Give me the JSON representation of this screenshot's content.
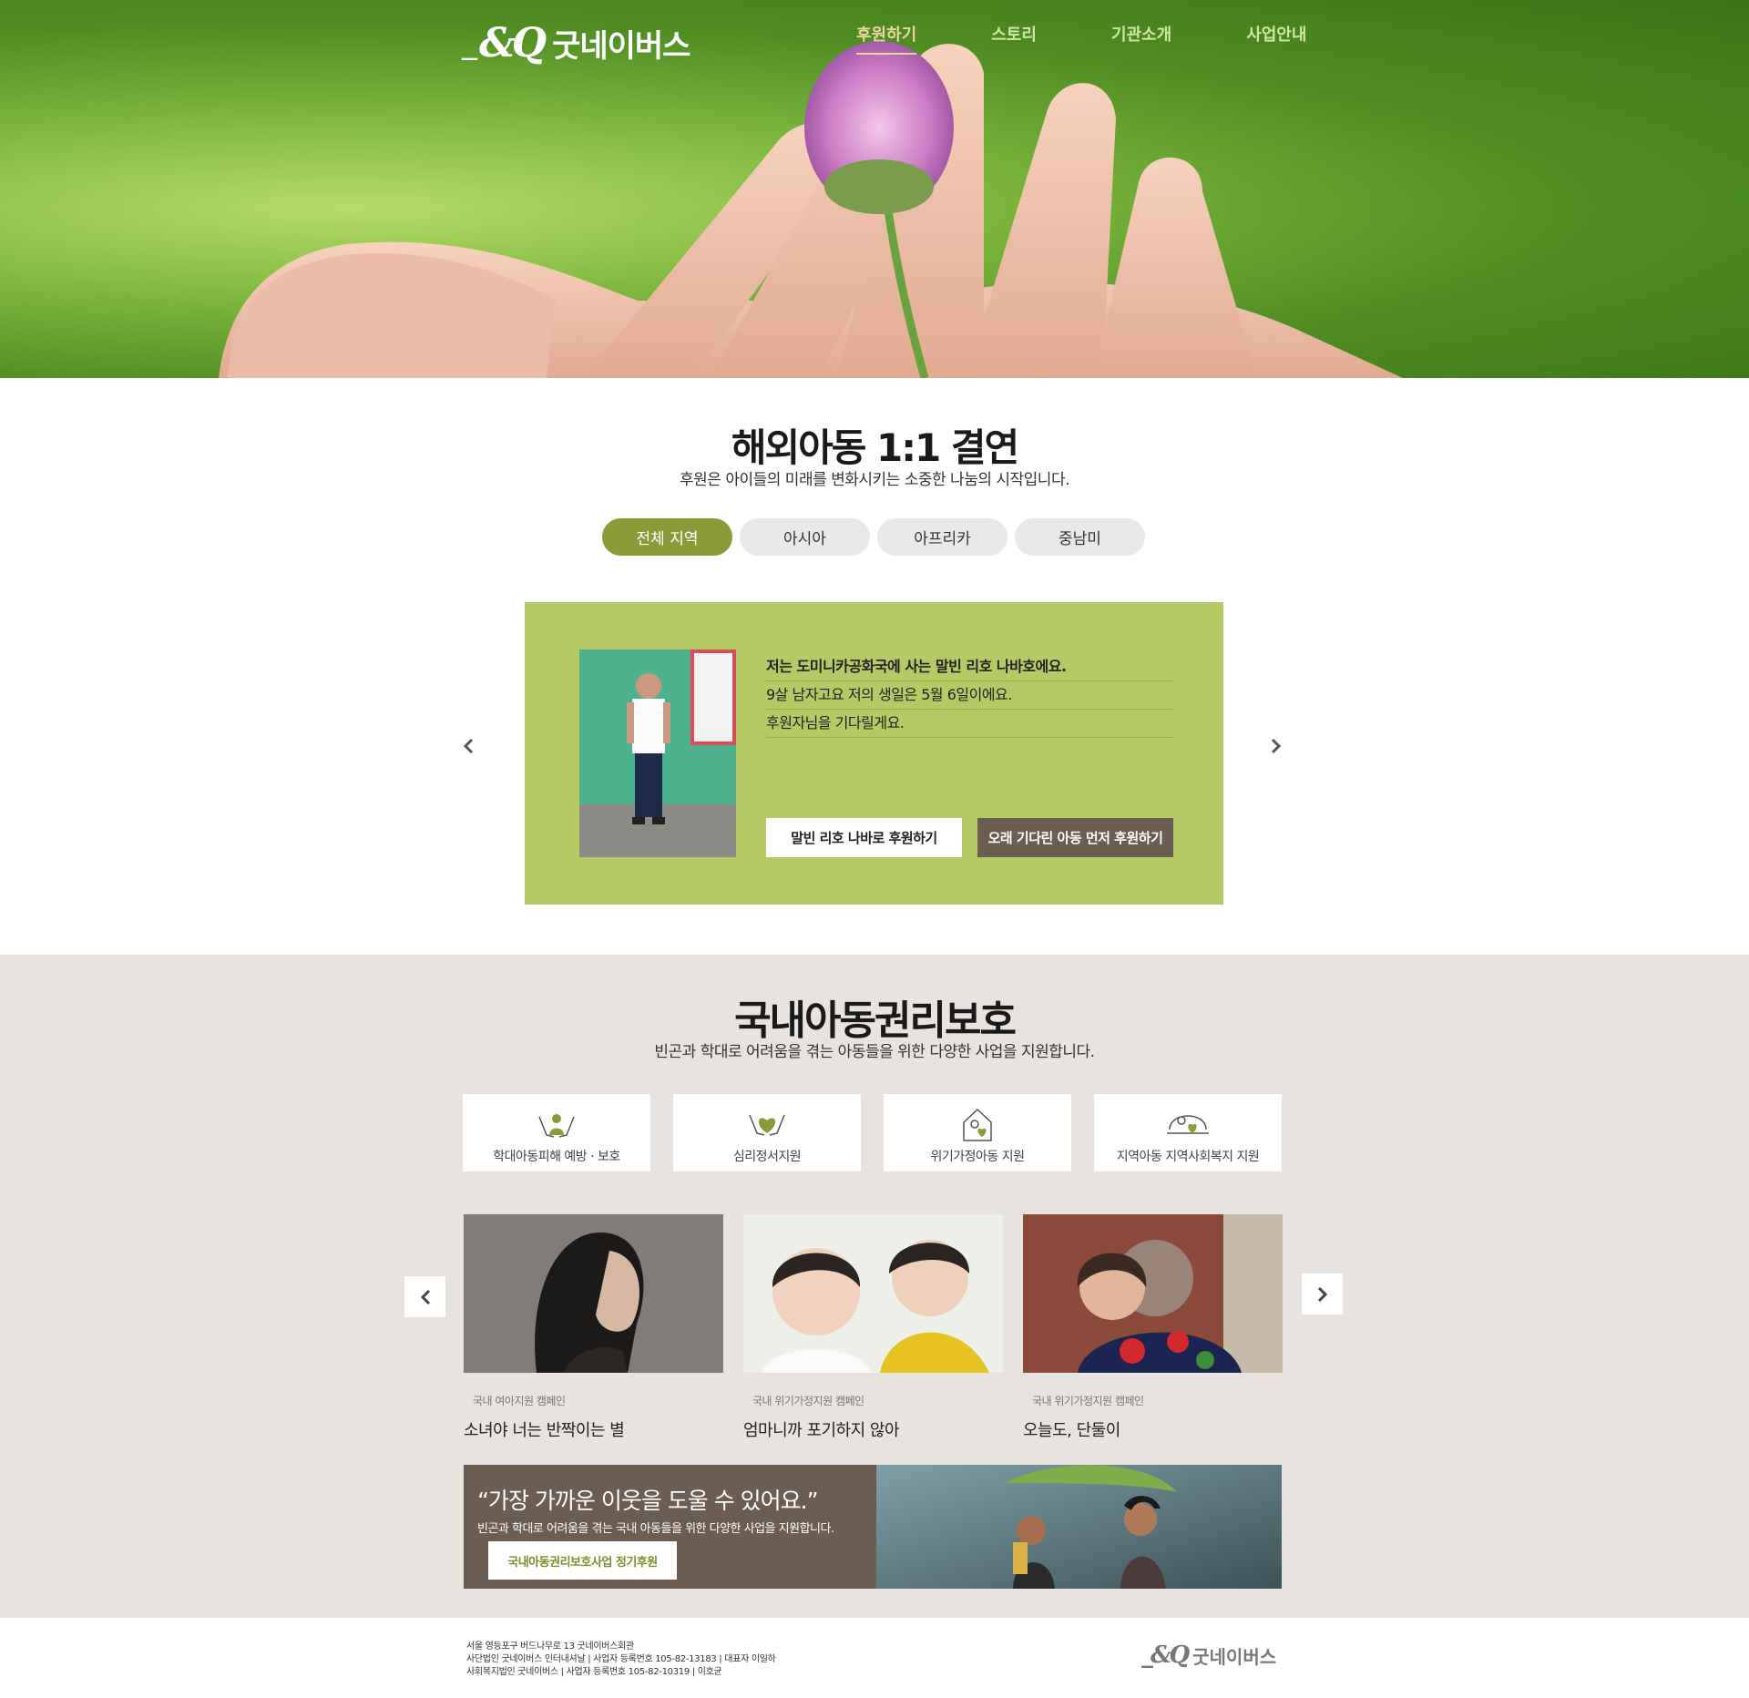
{
  "header": {
    "logo_name": "굿네이버스",
    "nav": [
      "후원하기",
      "스토리",
      "기관소개",
      "사업안내"
    ]
  },
  "sponsor": {
    "title": "해외아동 1:1 결연",
    "subtitle": "후원은 아이들의 미래를 변화시키는 소중한 나눔의 시작입니다.",
    "tabs": [
      "전체 지역",
      "아시아",
      "아프리카",
      "중남미"
    ],
    "active_tab": "전체 지역",
    "child": {
      "line1": "저는 도미니카공화국에 사는 말빈 리호 나바호에요.",
      "line2": "9살 남자고요 저의 생일은 5월 6일이에요.",
      "line3": "후원자님을 기다릴게요.",
      "button_primary": "말빈 리호 나바로 후원하기",
      "button_secondary": "오래 기다린 아동 먼저 후원하기"
    }
  },
  "domestic": {
    "title": "국내아동권리보호",
    "subtitle": "빈곤과 학대로 어려움을 겪는 아동들을 위한 다양한 사업을 지원합니다.",
    "categories": [
      {
        "label": "학대아동피해 예방 · 보호",
        "icon": "hands-heart-icon"
      },
      {
        "label": "심리정서지원",
        "icon": "heart-hands-icon"
      },
      {
        "label": "위기가정아동 지원",
        "icon": "house-heart-icon"
      },
      {
        "label": "지역아동 지역사회복지 지원",
        "icon": "community-heart-icon"
      }
    ],
    "stories": [
      {
        "tag": "국내 여아지원 캠페인",
        "title": "소녀야 너는 반짝이는 별"
      },
      {
        "tag": "국내 위기가정지원 캠페인",
        "title": "엄마니까 포기하지 않아"
      },
      {
        "tag": "국내 위기가정지원 캠페인",
        "title": "오늘도, 단둘이"
      }
    ],
    "banner": {
      "quote": "“가장 가까운 이웃을 도울 수 있어요.”",
      "desc": "빈곤과 학대로 어려움을 겪는 국내 아동들을 위한 다양한 사업을 지원합니다.",
      "cta": "국내아동권리보호사업 정기후원"
    }
  },
  "footer": {
    "address": "서울 영등포구 버드나무로 13 굿네이버스회관",
    "line2": "사단법인 굿네이버스 인터내셔날 | 사업자 등록번호 105-82-13183 | 대표자 이일하",
    "line3": "사회복지법인 굿네이버스 | 사업자 등록번호 105-82-10319 | 이호균",
    "logo_name": "굿네이버스"
  },
  "colors": {
    "accent_green": "#8a9b38",
    "card_green": "#b5c964",
    "brown": "#6b5d52",
    "section_beige": "#e8e3de"
  }
}
